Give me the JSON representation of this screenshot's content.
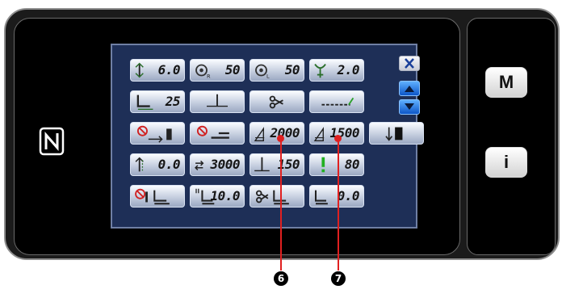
{
  "panel": {
    "hardware_buttons": {
      "mode_label": "M",
      "info_label": "i"
    },
    "rows": [
      [
        {
          "icon": "stitch-pitch-icon",
          "value": "6.0"
        },
        {
          "icon": "bobbin-tension-r-icon",
          "value": "50"
        },
        {
          "icon": "bobbin-tension-l-icon",
          "value": "50"
        },
        {
          "icon": "thread-tension-icon",
          "value": "2.0"
        }
      ],
      [
        {
          "icon": "presser-foot-icon",
          "value": "25"
        },
        {
          "icon": "needle-position-icon",
          "value": ""
        },
        {
          "icon": "thread-trimmer-icon",
          "value": ""
        },
        {
          "icon": "dashed-line-check-icon",
          "value": ""
        }
      ],
      [
        {
          "icon": "reverse-feed-off-icon",
          "value": ""
        },
        {
          "icon": "wiper-off-icon",
          "value": ""
        },
        {
          "icon": "max-speed-icon",
          "value": "2000"
        },
        {
          "icon": "speed-icon",
          "value": "1500"
        },
        {
          "icon": "needle-up-down-icon",
          "value": ""
        }
      ],
      [
        {
          "icon": "feed-amount-icon",
          "value": "0.0"
        },
        {
          "icon": "soft-start-speed-icon",
          "value": "3000"
        },
        {
          "icon": "needle-stop-icon",
          "value": "150"
        },
        {
          "icon": "alarm-icon",
          "value": "80"
        }
      ],
      [
        {
          "icon": "presser-lift-off-icon",
          "value": ""
        },
        {
          "icon": "presser-height-icon",
          "value": "10.0"
        },
        {
          "icon": "trim-presser-icon",
          "value": ""
        },
        {
          "icon": "presser-height-2-icon",
          "value": "0.0"
        }
      ]
    ],
    "nav": {
      "close": "close-icon",
      "up": "arrow-up-icon",
      "down": "arrow-down-icon"
    }
  },
  "callouts": {
    "first": "6",
    "second": "7"
  },
  "colors": {
    "lcd_bg": "#1e2f57",
    "accent": "#e02020",
    "nav_blue": "#0d56c8"
  }
}
